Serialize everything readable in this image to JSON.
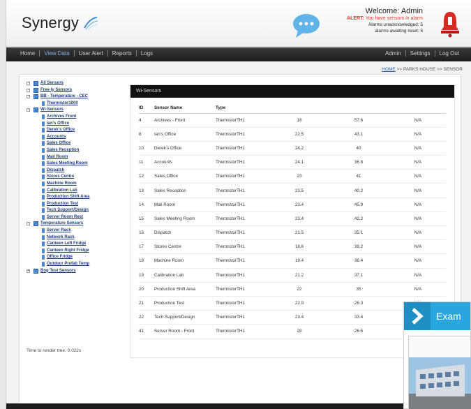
{
  "header": {
    "logo_text": "Synergy",
    "welcome": "Welcome: Admin",
    "alert_prefix": "ALERT:",
    "alert_text": "You have sensors in alarm",
    "unacknowledged": "Alarms unacknowledged: 5",
    "awaiting_reset": "alarms awaiting reset: 5"
  },
  "nav": {
    "left": [
      "Home",
      "View Data",
      "User Alert",
      "Reports",
      "Logs"
    ],
    "right": [
      "Admin",
      "Settings",
      "Log Out"
    ],
    "active_index": 1
  },
  "breadcrumb": {
    "home": "HOME",
    "rest": ">> PARKS HOUSE >> SENSOR"
  },
  "tree": [
    {
      "label": "All Sensors",
      "level": 0,
      "type": "folder",
      "exp": "-"
    },
    {
      "label": "Free-ly Sensors",
      "level": 0,
      "type": "folder",
      "exp": "-"
    },
    {
      "label": "BB - Temperature - CEC",
      "level": 0,
      "type": "folder",
      "exp": "-"
    },
    {
      "label": "Thermistor1000",
      "level": 1,
      "type": "leaf"
    },
    {
      "label": "Wi-Sensors",
      "level": 0,
      "type": "folder",
      "exp": "-"
    },
    {
      "label": "Archives Front",
      "level": 1,
      "type": "leaf"
    },
    {
      "label": "Ian's Office",
      "level": 1,
      "type": "leaf"
    },
    {
      "label": "Derek's Office",
      "level": 1,
      "type": "leaf"
    },
    {
      "label": "Accounts",
      "level": 1,
      "type": "leaf"
    },
    {
      "label": "Sales Office",
      "level": 1,
      "type": "leaf"
    },
    {
      "label": "Sales Reception",
      "level": 1,
      "type": "leaf"
    },
    {
      "label": "Mail Room",
      "level": 1,
      "type": "leaf"
    },
    {
      "label": "Sales Meeting Room",
      "level": 1,
      "type": "leaf"
    },
    {
      "label": "Dispatch",
      "level": 1,
      "type": "leaf"
    },
    {
      "label": "Stores Centre",
      "level": 1,
      "type": "leaf"
    },
    {
      "label": "Machine Room",
      "level": 1,
      "type": "leaf"
    },
    {
      "label": "Calibration Lab",
      "level": 1,
      "type": "leaf"
    },
    {
      "label": "Production Shift Area",
      "level": 1,
      "type": "leaf"
    },
    {
      "label": "Production Test",
      "level": 1,
      "type": "leaf"
    },
    {
      "label": "Tech Support/Design",
      "level": 1,
      "type": "leaf"
    },
    {
      "label": "Server Room Rest",
      "level": 1,
      "type": "leaf"
    },
    {
      "label": "Temperature Sensors",
      "level": 0,
      "type": "folder",
      "exp": "-"
    },
    {
      "label": "Server Rack",
      "level": 1,
      "type": "leaf"
    },
    {
      "label": "Network Rack",
      "level": 1,
      "type": "leaf"
    },
    {
      "label": "Canteen Left Fridge",
      "level": 1,
      "type": "leaf"
    },
    {
      "label": "Canteen Right Fridge",
      "level": 1,
      "type": "leaf"
    },
    {
      "label": "Office Fridge",
      "level": 1,
      "type": "leaf"
    },
    {
      "label": "Outdoor Prefab Temp",
      "level": 1,
      "type": "leaf"
    },
    {
      "label": "Bog Test Sensors",
      "level": 0,
      "type": "folder",
      "exp": "+"
    }
  ],
  "render_time": "Time to render tree: 0.022s",
  "sensor_panel": {
    "title": "Wi-Sensors",
    "columns": [
      "ID",
      "Sensor Name",
      "Type",
      "",
      "",
      ""
    ],
    "rows": [
      [
        "4",
        "Archives - Front",
        "ThermistorTH1",
        "18",
        "57.6",
        "N/A"
      ],
      [
        "8",
        "Ian's Office",
        "ThermistorTH1",
        "22.5",
        "43.1",
        "N/A"
      ],
      [
        "10",
        "Derek's Office",
        "ThermistorTH1",
        "24.2",
        "40",
        "N/A"
      ],
      [
        "11",
        "Accounts",
        "ThermistorTH1",
        "24.1",
        "36.8",
        "N/A"
      ],
      [
        "12",
        "Sales Office",
        "ThermistorTH1",
        "23",
        "41",
        "N/A"
      ],
      [
        "13",
        "Sales Reception",
        "ThermistorTH1",
        "23.5",
        "40.2",
        "N/A"
      ],
      [
        "14",
        "Mail Room",
        "ThermistorTH1",
        "23.4",
        "45.9",
        "N/A"
      ],
      [
        "15",
        "Sales Meeting Room",
        "ThermistorTH1",
        "23.4",
        "42.2",
        "N/A"
      ],
      [
        "16",
        "Dispatch",
        "ThermistorTH1",
        "21.5",
        "35.1",
        "N/A"
      ],
      [
        "17",
        "Stores Centre",
        "ThermistorTH1",
        "18.6",
        "39.2",
        "N/A"
      ],
      [
        "18",
        "Machine Room",
        "ThermistorTH1",
        "19.4",
        "38.4",
        "N/A"
      ],
      [
        "19",
        "Calibration Lab",
        "ThermistorTH1",
        "21.2",
        "37.1",
        "N/A"
      ],
      [
        "20",
        "Production Shift Area",
        "ThermistorTH1",
        "22",
        "35",
        "N/A"
      ],
      [
        "21",
        "Production Test",
        "ThermistorTH1",
        "22.9",
        "26.3",
        "N/A"
      ],
      [
        "22",
        "Tech Support/Design",
        "ThermistorTH1",
        "23.4",
        "33.4",
        "N/A"
      ],
      [
        "41",
        "Server Room - Front",
        "ThermistorTH1",
        "28",
        "26.5",
        "N/A"
      ]
    ]
  },
  "popup": {
    "title": "Exam"
  },
  "colors": {
    "nav_bg": "#1d1d1d",
    "nav_active": "#7fb2e0",
    "tree_link": "#1f3c7a",
    "alert_red": "#d23a2a",
    "popup_blue": "#2aa6de"
  }
}
